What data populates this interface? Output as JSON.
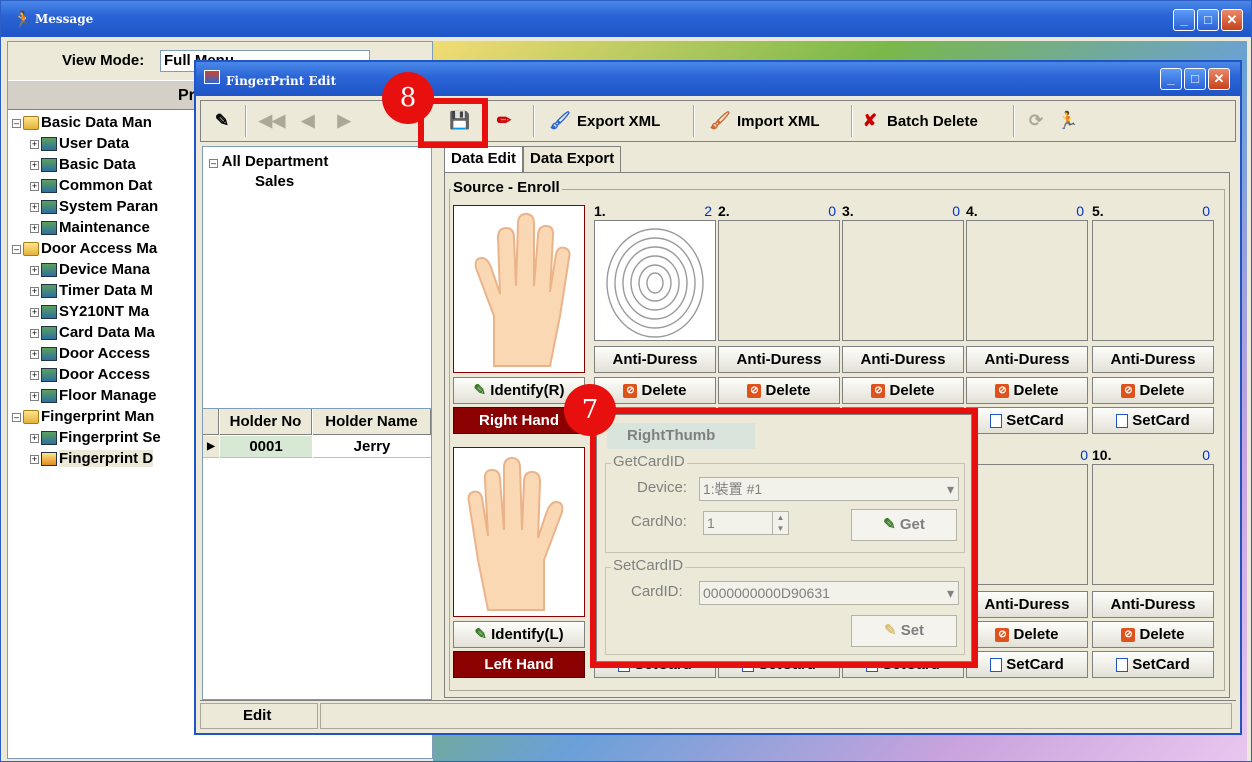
{
  "outer": {
    "title": "Message",
    "view_mode_label": "View Mode:",
    "view_mode_value": "Full Menu",
    "prog_header": "Prog",
    "tree": [
      {
        "label": "Basic Data Man",
        "level": 1
      },
      {
        "label": "User Data",
        "level": 2
      },
      {
        "label": "Basic Data",
        "level": 2
      },
      {
        "label": "Common Dat",
        "level": 2
      },
      {
        "label": "System Paran",
        "level": 2
      },
      {
        "label": "Maintenance",
        "level": 2
      },
      {
        "label": "Door Access Ma",
        "level": 1
      },
      {
        "label": "Device Mana",
        "level": 2
      },
      {
        "label": "Timer Data M",
        "level": 2
      },
      {
        "label": "SY210NT Ma",
        "level": 2
      },
      {
        "label": "Card Data Ma",
        "level": 2
      },
      {
        "label": "Door Access",
        "level": 2
      },
      {
        "label": "Door Access",
        "level": 2
      },
      {
        "label": "Floor Manage",
        "level": 2
      },
      {
        "label": "Fingerprint Man",
        "level": 1
      },
      {
        "label": "Fingerprint Se",
        "level": 2
      },
      {
        "label": "Fingerprint D",
        "level": 2
      }
    ]
  },
  "fp": {
    "title": "FingerPrint Edit",
    "toolbar": {
      "export_label": "Export XML",
      "import_label": "Import XML",
      "batch_delete_label": "Batch Delete"
    },
    "dept_tree": {
      "root": "All Department",
      "child": "Sales"
    },
    "grid": {
      "headers": [
        "Holder No",
        "Holder Name"
      ],
      "rows": [
        {
          "no": "0001",
          "name": "Jerry"
        }
      ]
    },
    "status": {
      "mode": "Edit"
    },
    "tabs": [
      "Data Edit",
      "Data Export"
    ],
    "group_label": "Source - Enroll",
    "right_hand": {
      "identify_label": "Identify(R)",
      "hand_label": "Right Hand"
    },
    "left_hand": {
      "identify_label": "Identify(L)",
      "hand_label": "Left Hand"
    },
    "slots_top": [
      {
        "num": "1.",
        "count": "2"
      },
      {
        "num": "2.",
        "count": "0"
      },
      {
        "num": "3.",
        "count": "0"
      },
      {
        "num": "4.",
        "count": "0"
      },
      {
        "num": "5.",
        "count": "0"
      }
    ],
    "slots_bottom_visible": [
      {
        "num": "10.",
        "count": "0"
      }
    ],
    "slot_bottom_count_9": "0",
    "anti_duress_label": "Anti-Duress",
    "delete_label": "Delete",
    "setcard_label": "SetCard",
    "popup": {
      "thumb_label": "RightThumb",
      "get_group": "GetCardID",
      "device_label": "Device:",
      "device_value": "1:裝置 #1",
      "cardno_label": "CardNo:",
      "cardno_value": "1",
      "get_button": "Get",
      "set_group": "SetCardID",
      "cardid_label": "CardID:",
      "cardid_value": "0000000000D90631",
      "set_button": "Set"
    }
  },
  "annotations": {
    "badge_7": "7",
    "badge_8": "8",
    "accent": "#e8100e"
  }
}
